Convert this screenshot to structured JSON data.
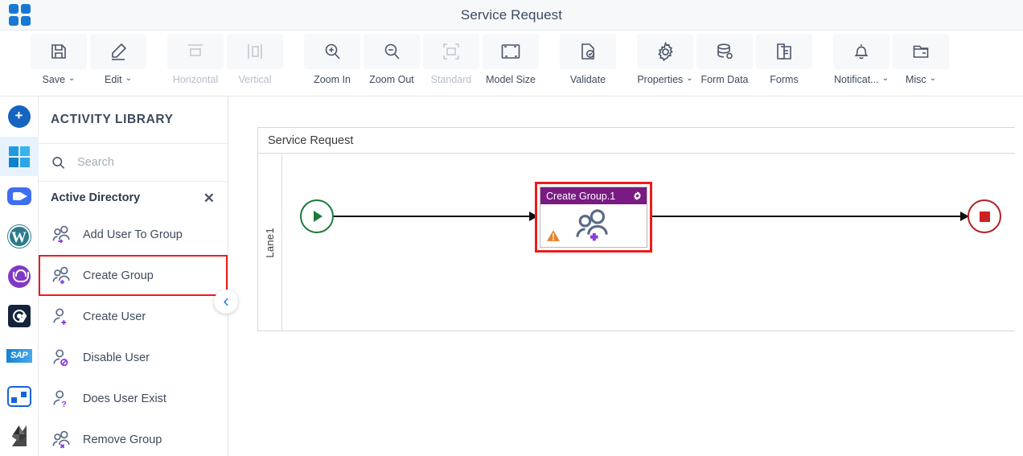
{
  "titlebar": {
    "app_logo": "grid-logo",
    "title": "Service Request"
  },
  "toolbar": {
    "items": [
      {
        "label": "Save",
        "icon": "save-icon",
        "caret": "⌄",
        "disabled": false
      },
      {
        "label": "Edit",
        "icon": "pencil-icon",
        "caret": "⌄",
        "disabled": false
      },
      {
        "label": "Horizontal",
        "icon": "horizontal-icon",
        "caret": "",
        "disabled": true
      },
      {
        "label": "Vertical",
        "icon": "vertical-icon",
        "caret": "",
        "disabled": true
      },
      {
        "label": "Zoom In",
        "icon": "zoom-in-icon",
        "caret": "",
        "disabled": false
      },
      {
        "label": "Zoom Out",
        "icon": "zoom-out-icon",
        "caret": "",
        "disabled": false
      },
      {
        "label": "Standard",
        "icon": "standard-icon",
        "caret": "",
        "disabled": true
      },
      {
        "label": "Model Size",
        "icon": "model-size-icon",
        "caret": "",
        "disabled": false
      },
      {
        "label": "Validate",
        "icon": "validate-icon",
        "caret": "",
        "disabled": false
      },
      {
        "label": "Properties",
        "icon": "gear-icon",
        "caret": "⌄",
        "disabled": false
      },
      {
        "label": "Form Data",
        "icon": "database-icon",
        "caret": "",
        "disabled": false
      },
      {
        "label": "Forms",
        "icon": "document-icon",
        "caret": "",
        "disabled": false
      },
      {
        "label": "Notificat...",
        "icon": "bell-icon",
        "caret": "⌄",
        "disabled": false
      },
      {
        "label": "Misc",
        "icon": "folder-icon",
        "caret": "⌄",
        "disabled": false
      }
    ]
  },
  "rail": {
    "items": [
      {
        "name": "add-button",
        "icon": "plus-circle-icon",
        "active": false
      },
      {
        "name": "microsoft-connector",
        "icon": "windows-icon",
        "active": true
      },
      {
        "name": "zoom-connector",
        "icon": "video-camera-icon",
        "active": false
      },
      {
        "name": "wordpress-connector",
        "icon": "wordpress-icon",
        "active": false
      },
      {
        "name": "support-connector",
        "icon": "headset-icon",
        "active": false
      },
      {
        "name": "servicenow-connector",
        "icon": "servicenow-icon",
        "active": false
      },
      {
        "name": "sap-connector",
        "icon": "sap-icon",
        "active": false
      },
      {
        "name": "powerautomate-connector",
        "icon": "power-automate-icon",
        "active": false
      },
      {
        "name": "ethereum-connector",
        "icon": "ethereum-icon",
        "active": false
      }
    ]
  },
  "library": {
    "title": "ACTIVITY LIBRARY",
    "search_placeholder": "Search",
    "search_value": "",
    "group": {
      "name": "Active Directory",
      "close_label": "✕"
    },
    "activities": [
      {
        "label": "Add User To Group",
        "icon": "add-user-to-group-icon",
        "selected": false
      },
      {
        "label": "Create Group",
        "icon": "create-group-icon",
        "selected": true
      },
      {
        "label": "Create User",
        "icon": "create-user-icon",
        "selected": false
      },
      {
        "label": "Disable User",
        "icon": "disable-user-icon",
        "selected": false
      },
      {
        "label": "Does User Exist",
        "icon": "does-user-exist-icon",
        "selected": false
      },
      {
        "label": "Remove Group",
        "icon": "remove-group-icon",
        "selected": false
      }
    ],
    "collapse_icon": "chevron-left-icon"
  },
  "canvas": {
    "pool_title": "Service Request",
    "lane_label": "Lane1",
    "start_event": "start-event",
    "end_event": "end-event",
    "task": {
      "name": "Create Group.1",
      "gear_icon": "gear-icon",
      "warning_icon": "warning-icon",
      "body_icon": "create-group-icon",
      "selected": true
    }
  },
  "colors": {
    "accent_blue": "#1464d8",
    "selection_red": "#ee1b1b",
    "task_header_purple": "#7a1b83",
    "start_green": "#1d7a3c",
    "end_red": "#cf2020",
    "warning_orange": "#e8832a",
    "icon_purple": "#8b3ae0"
  }
}
